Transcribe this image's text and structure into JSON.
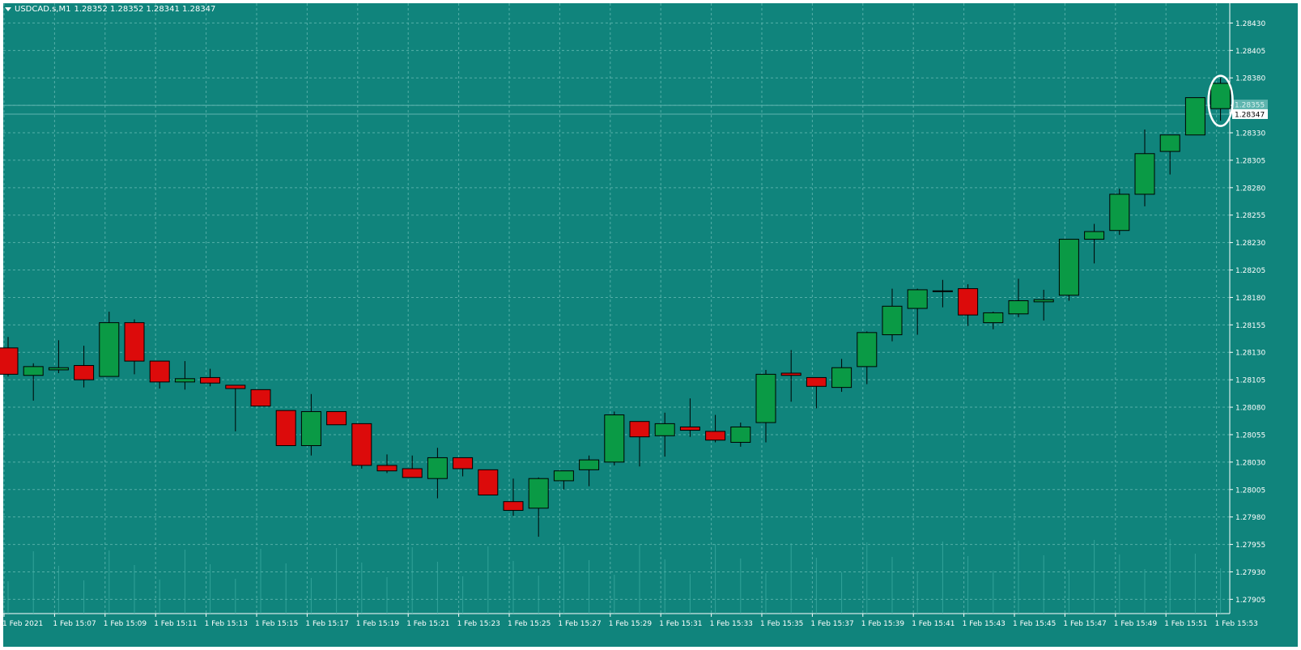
{
  "symbol_info": {
    "symbol": "USDCAD.s,M1",
    "ohlc_readout": "1.28352 1.28352 1.28341 1.28347"
  },
  "colors": {
    "background": "#10847c",
    "grid": "#66bab4",
    "bull_fill": "#0a9a45",
    "bear_fill": "#dc0b0b",
    "candle_outline": "#000000",
    "wick": "#000000",
    "axis_text": "#ffffff",
    "bid_line": "#5fb5af",
    "volume": "#3fb0a6",
    "annotation": "#ffffff"
  },
  "current_price": {
    "bid": "1.28347",
    "ask": "1.28355"
  },
  "chart_data": {
    "type": "candlestick",
    "symbol": "USDCAD.s",
    "timeframe": "M1",
    "y_axis": {
      "range": [
        1.27892,
        1.28448
      ],
      "ticks": [
        "1.28430",
        "1.28405",
        "1.28380",
        "1.28355",
        "1.28330",
        "1.28305",
        "1.28280",
        "1.28255",
        "1.28230",
        "1.28205",
        "1.28180",
        "1.28155",
        "1.28130",
        "1.28105",
        "1.28080",
        "1.28055",
        "1.28030",
        "1.28005",
        "1.27980",
        "1.27955",
        "1.27930",
        "1.27905"
      ]
    },
    "x_axis": {
      "tick_labels": [
        "1 Feb 2021",
        "1 Feb 15:07",
        "1 Feb 15:09",
        "1 Feb 15:11",
        "1 Feb 15:13",
        "1 Feb 15:15",
        "1 Feb 15:17",
        "1 Feb 15:19",
        "1 Feb 15:21",
        "1 Feb 15:23",
        "1 Feb 15:25",
        "1 Feb 15:27",
        "1 Feb 15:29",
        "1 Feb 15:31",
        "1 Feb 15:33",
        "1 Feb 15:35",
        "1 Feb 15:37",
        "1 Feb 15:39",
        "1 Feb 15:41",
        "1 Feb 15:43",
        "1 Feb 15:45",
        "1 Feb 15:47",
        "1 Feb 15:49",
        "1 Feb 15:51",
        "1 Feb 15:53"
      ]
    },
    "grid": true,
    "candles": [
      {
        "o": 1.28134,
        "h": 1.28144,
        "l": 1.28108,
        "c": 1.2811
      },
      {
        "o": 1.28109,
        "h": 1.2812,
        "l": 1.28086,
        "c": 1.28117
      },
      {
        "o": 1.28114,
        "h": 1.28141,
        "l": 1.28111,
        "c": 1.28116
      },
      {
        "o": 1.28118,
        "h": 1.28136,
        "l": 1.28098,
        "c": 1.28105
      },
      {
        "o": 1.28108,
        "h": 1.28167,
        "l": 1.28108,
        "c": 1.28157
      },
      {
        "o": 1.28157,
        "h": 1.2816,
        "l": 1.2811,
        "c": 1.28122
      },
      {
        "o": 1.28122,
        "h": 1.28122,
        "l": 1.28097,
        "c": 1.28103
      },
      {
        "o": 1.28103,
        "h": 1.28122,
        "l": 1.28096,
        "c": 1.28106
      },
      {
        "o": 1.28107,
        "h": 1.28115,
        "l": 1.28099,
        "c": 1.28102
      },
      {
        "o": 1.281,
        "h": 1.281,
        "l": 1.28058,
        "c": 1.28097
      },
      {
        "o": 1.28096,
        "h": 1.28096,
        "l": 1.28081,
        "c": 1.28081
      },
      {
        "o": 1.28077,
        "h": 1.28077,
        "l": 1.28045,
        "c": 1.28045
      },
      {
        "o": 1.28045,
        "h": 1.28092,
        "l": 1.28036,
        "c": 1.28076
      },
      {
        "o": 1.28076,
        "h": 1.28076,
        "l": 1.28064,
        "c": 1.28064
      },
      {
        "o": 1.28065,
        "h": 1.28065,
        "l": 1.28024,
        "c": 1.28027
      },
      {
        "o": 1.28027,
        "h": 1.28037,
        "l": 1.2802,
        "c": 1.28022
      },
      {
        "o": 1.28024,
        "h": 1.28036,
        "l": 1.28016,
        "c": 1.28016
      },
      {
        "o": 1.28015,
        "h": 1.28043,
        "l": 1.27997,
        "c": 1.28034
      },
      {
        "o": 1.28034,
        "h": 1.28034,
        "l": 1.28017,
        "c": 1.28024
      },
      {
        "o": 1.28023,
        "h": 1.28023,
        "l": 1.28,
        "c": 1.28
      },
      {
        "o": 1.27994,
        "h": 1.28015,
        "l": 1.27981,
        "c": 1.27986
      },
      {
        "o": 1.27988,
        "h": 1.28016,
        "l": 1.27962,
        "c": 1.28015
      },
      {
        "o": 1.28013,
        "h": 1.28022,
        "l": 1.28005,
        "c": 1.28022
      },
      {
        "o": 1.28023,
        "h": 1.28036,
        "l": 1.28008,
        "c": 1.28032
      },
      {
        "o": 1.2803,
        "h": 1.28076,
        "l": 1.28027,
        "c": 1.28073
      },
      {
        "o": 1.28067,
        "h": 1.28067,
        "l": 1.28026,
        "c": 1.28053
      },
      {
        "o": 1.28054,
        "h": 1.28075,
        "l": 1.28035,
        "c": 1.28065
      },
      {
        "o": 1.28062,
        "h": 1.28088,
        "l": 1.28053,
        "c": 1.28059
      },
      {
        "o": 1.28058,
        "h": 1.28073,
        "l": 1.28048,
        "c": 1.2805
      },
      {
        "o": 1.28048,
        "h": 1.28066,
        "l": 1.28044,
        "c": 1.28062
      },
      {
        "o": 1.28066,
        "h": 1.28114,
        "l": 1.28048,
        "c": 1.2811
      },
      {
        "o": 1.28111,
        "h": 1.28132,
        "l": 1.28085,
        "c": 1.28109
      },
      {
        "o": 1.28107,
        "h": 1.28107,
        "l": 1.28079,
        "c": 1.28099
      },
      {
        "o": 1.28098,
        "h": 1.28124,
        "l": 1.28094,
        "c": 1.28116
      },
      {
        "o": 1.28117,
        "h": 1.28149,
        "l": 1.28101,
        "c": 1.28148
      },
      {
        "o": 1.28146,
        "h": 1.28188,
        "l": 1.2814,
        "c": 1.28172
      },
      {
        "o": 1.2817,
        "h": 1.28188,
        "l": 1.28146,
        "c": 1.28187
      },
      {
        "o": 1.28186,
        "h": 1.28196,
        "l": 1.28171,
        "c": 1.28186
      },
      {
        "o": 1.28188,
        "h": 1.28192,
        "l": 1.28154,
        "c": 1.28164
      },
      {
        "o": 1.28157,
        "h": 1.28167,
        "l": 1.28151,
        "c": 1.28166
      },
      {
        "o": 1.28165,
        "h": 1.28197,
        "l": 1.28162,
        "c": 1.28177
      },
      {
        "o": 1.28176,
        "h": 1.28187,
        "l": 1.28159,
        "c": 1.28178
      },
      {
        "o": 1.28182,
        "h": 1.28233,
        "l": 1.28177,
        "c": 1.28233
      },
      {
        "o": 1.28233,
        "h": 1.28247,
        "l": 1.28211,
        "c": 1.2824
      },
      {
        "o": 1.28241,
        "h": 1.28279,
        "l": 1.28237,
        "c": 1.28274
      },
      {
        "o": 1.28274,
        "h": 1.28333,
        "l": 1.28263,
        "c": 1.28311
      },
      {
        "o": 1.28313,
        "h": 1.28328,
        "l": 1.28292,
        "c": 1.28328
      },
      {
        "o": 1.28328,
        "h": 1.28362,
        "l": 1.28328,
        "c": 1.28362
      },
      {
        "o": 1.28352,
        "h": 1.2838,
        "l": 1.28341,
        "c": 1.28375
      }
    ]
  }
}
